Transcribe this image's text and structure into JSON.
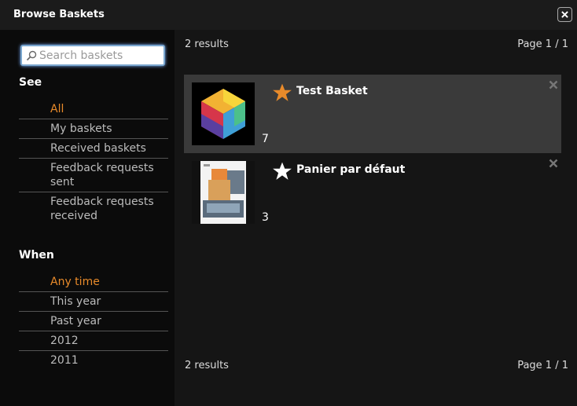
{
  "dialog": {
    "title": "Browse Baskets"
  },
  "search": {
    "placeholder": "Search baskets",
    "value": ""
  },
  "see": {
    "heading": "See",
    "items": [
      {
        "label": "All",
        "active": true
      },
      {
        "label": "My baskets",
        "active": false
      },
      {
        "label": "Received baskets",
        "active": false
      },
      {
        "label": "Feedback requests sent",
        "active": false
      },
      {
        "label": "Feedback requests received",
        "active": false
      }
    ]
  },
  "when": {
    "heading": "When",
    "items": [
      {
        "label": "Any time",
        "active": true
      },
      {
        "label": "This year",
        "active": false
      },
      {
        "label": "Past year",
        "active": false
      },
      {
        "label": "2012",
        "active": false
      },
      {
        "label": "2011",
        "active": false
      }
    ]
  },
  "results": {
    "count_label": "2 results",
    "page_label": "Page 1 / 1"
  },
  "baskets": [
    {
      "name": "Test Basket",
      "count": "7",
      "starred": true,
      "thumbnail": "colored-hexagon-cube"
    },
    {
      "name": "Panier par défaut",
      "count": "3",
      "starred": false,
      "thumbnail": "document-page"
    }
  ],
  "colors": {
    "accent": "#e88a2a",
    "active_filter": "#e88a2a",
    "selected_row": "#3a3a3a"
  }
}
